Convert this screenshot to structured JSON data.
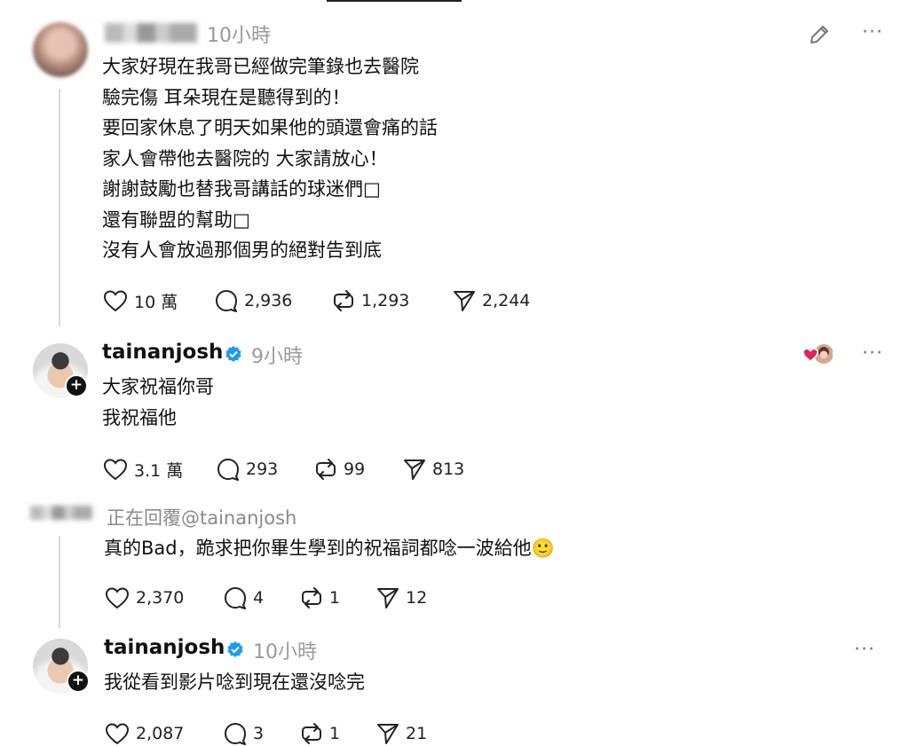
{
  "posts": [
    {
      "username": "",
      "time": "10小時",
      "lines": [
        "大家好現在我哥已經做完筆錄也去醫院",
        "驗完傷 耳朵現在是聽得到的！",
        "要回家休息了明天如果他的頭還會痛的話",
        "家人會帶他去醫院的 大家請放心！",
        "謝謝鼓勵也替我哥講話的球迷們□",
        "還有聯盟的幫助□",
        "沒有人會放過那個男的絕對告到底"
      ],
      "likes": "10 萬",
      "comments": "2,936",
      "reposts": "1,293",
      "shares": "2,244"
    },
    {
      "username": "tainanjosh",
      "time": "9小時",
      "lines": [
        "大家祝福你哥",
        "我祝福他"
      ],
      "likes": "3.1 萬",
      "comments": "293",
      "reposts": "99",
      "shares": "813"
    },
    {
      "username": "",
      "reply_to": "正在回覆@tainanjosh",
      "lines": [
        "真的Bad，跪求把你畢生學到的祝福詞都唸一波給他🙂"
      ],
      "likes": "2,370",
      "comments": "4",
      "reposts": "1",
      "shares": "12"
    },
    {
      "username": "tainanjosh",
      "time": "10小時",
      "lines": [
        "我從看到影片唸到現在還沒唸完"
      ],
      "likes": "2,087",
      "comments": "3",
      "reposts": "1",
      "shares": "21"
    }
  ],
  "icons": {
    "like": "heart-icon",
    "comment": "comment-icon",
    "repost": "repost-icon",
    "share": "share-icon",
    "more": "more-icon",
    "edit": "pencil-icon",
    "verified": "verified-badge-icon"
  },
  "colors": {
    "verified": "#1d9bf0",
    "time_text": "#9a9a9a",
    "heart_react": "#e0245e"
  }
}
